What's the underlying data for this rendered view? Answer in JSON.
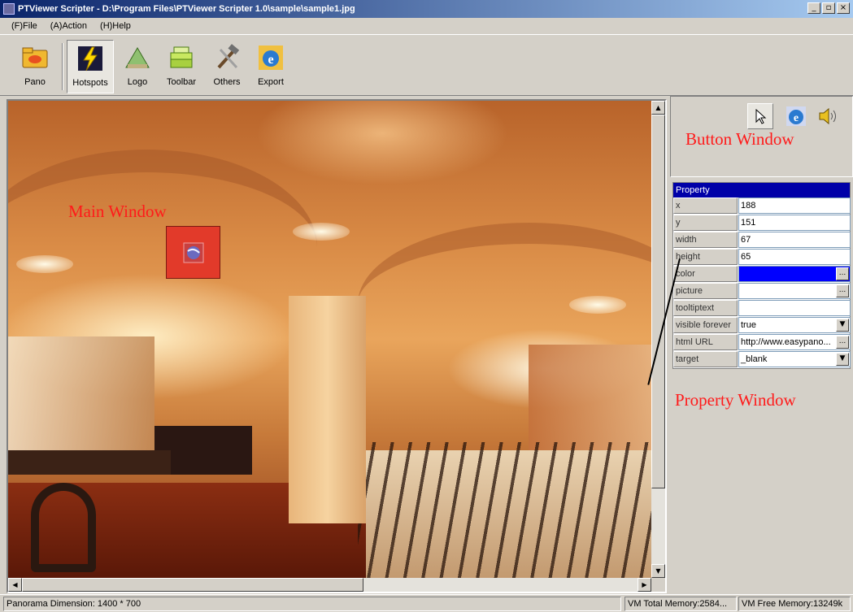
{
  "window": {
    "title": "PTViewer Scripter - D:\\Program Files\\PTViewer Scripter 1.0\\sample\\sample1.jpg",
    "min_label": "_",
    "max_label": "▫",
    "close_label": "×"
  },
  "menu": [
    {
      "label": "(F)File"
    },
    {
      "label": "(A)Action"
    },
    {
      "label": "(H)Help"
    }
  ],
  "toolbar": [
    {
      "label": "Pano",
      "icon": "folder-icon"
    },
    {
      "label": "Hotspots",
      "icon": "lightning-icon",
      "active": true
    },
    {
      "label": "Logo",
      "icon": "logo-icon"
    },
    {
      "label": "Toolbar",
      "icon": "stack-icon"
    },
    {
      "label": "Others",
      "icon": "tools-icon"
    },
    {
      "label": "Export",
      "icon": "internet-explorer-icon"
    }
  ],
  "annotations": {
    "main_window": "Main Window",
    "button_window": "Button Window",
    "property_window": "Property Window"
  },
  "button_window": {
    "buttons": [
      {
        "icon": "pointer-icon",
        "pressed": true
      },
      {
        "icon": "internet-explorer-icon"
      },
      {
        "icon": "speaker-icon"
      }
    ]
  },
  "properties": {
    "header": "Property",
    "rows": [
      {
        "key": "x",
        "value": "188"
      },
      {
        "key": "y",
        "value": "151"
      },
      {
        "key": "width",
        "value": "67"
      },
      {
        "key": "height",
        "value": "65"
      },
      {
        "key": "color",
        "value": "",
        "swatch": "#0000ff",
        "button": "..."
      },
      {
        "key": "picture",
        "value": "",
        "button": "..."
      },
      {
        "key": "tooltiptext",
        "value": ""
      },
      {
        "key": "visible forever",
        "value": "true",
        "button": "▼"
      },
      {
        "key": "html URL",
        "value": "http://www.easypano...",
        "button": "..."
      },
      {
        "key": "target",
        "value": "_blank",
        "button": "▼"
      }
    ]
  },
  "status": {
    "dimension": "Panorama Dimension: 1400 * 700",
    "total_memory": "VM Total Memory:2584...",
    "free_memory": "VM Free Memory:13249k"
  },
  "scroll": {
    "up": "▲",
    "down": "▼",
    "left": "◀",
    "right": "▶"
  }
}
